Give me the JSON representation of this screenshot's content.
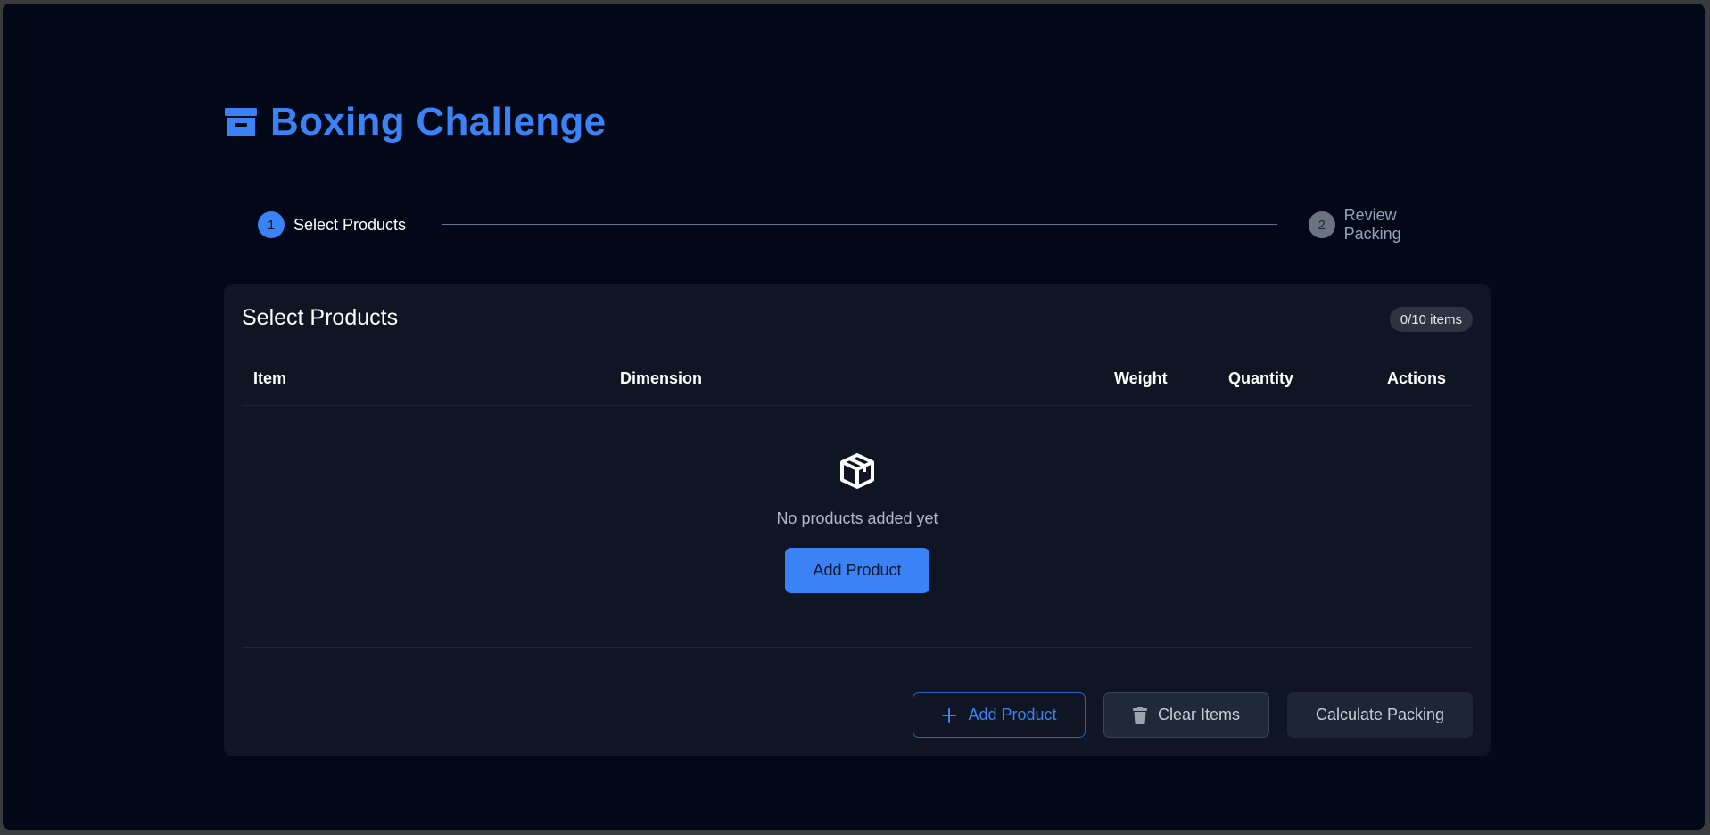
{
  "app": {
    "title": "Boxing Challenge",
    "logo_icon": "archive-box-icon",
    "accent_color": "#3b82f6"
  },
  "stepper": {
    "steps": [
      {
        "number": "1",
        "label": "Select Products",
        "state": "active"
      },
      {
        "number": "2",
        "label": "Review Packing",
        "state": "inactive"
      }
    ]
  },
  "card": {
    "title": "Select Products",
    "count_badge": "0/10 items",
    "table": {
      "columns": [
        "Item",
        "Dimension",
        "Weight",
        "Quantity",
        "Actions"
      ],
      "rows": []
    },
    "empty_state": {
      "icon": "package-box-icon",
      "message": "No products added yet",
      "button_label": "Add Product"
    },
    "footer": {
      "add_label": "Add Product",
      "add_icon": "plus-icon",
      "clear_label": "Clear Items",
      "clear_icon": "trash-icon",
      "calculate_label": "Calculate Packing"
    }
  }
}
